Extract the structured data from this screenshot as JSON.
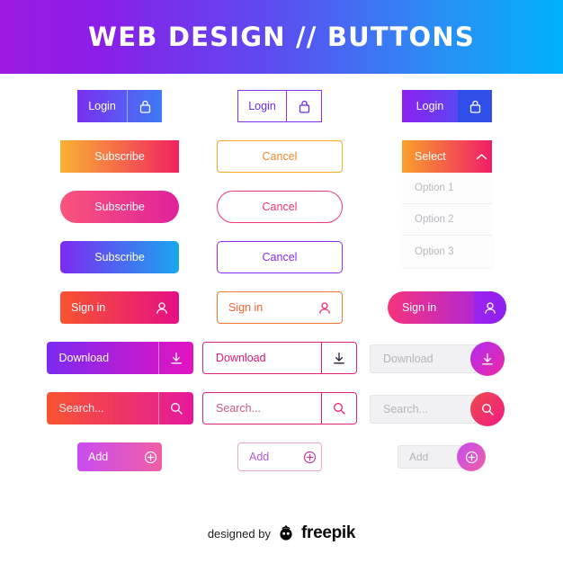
{
  "header": {
    "title": "WEB DESIGN // BUTTONS"
  },
  "footer": {
    "designed_by": "designed by",
    "brand": "freepik",
    "logo_icon": "freepik-robot-icon"
  },
  "columns": [
    {
      "name": "filled-gradient",
      "buttons": [
        {
          "label": "Login",
          "icon": "lock-icon",
          "style": "gradient-violet-blue"
        },
        {
          "label": "Subscribe",
          "icon": "",
          "style": "gradient-orange-pink"
        },
        {
          "label": "Subscribe",
          "icon": "",
          "style": "gradient-pink-magenta-rounded"
        },
        {
          "label": "Subscribe",
          "icon": "",
          "style": "gradient-violet-cyan-rounded"
        },
        {
          "label": "Sign in",
          "icon": "user-icon",
          "style": "gradient-orange-magenta"
        },
        {
          "label": "Download",
          "icon": "download-icon",
          "style": "gradient-violet-magenta"
        },
        {
          "label": "Search...",
          "icon": "search-icon",
          "style": "gradient-orange-magenta"
        },
        {
          "label": "Add",
          "icon": "plus-circle-icon",
          "style": "gradient-purple-pink-rounded"
        }
      ]
    },
    {
      "name": "outline",
      "buttons": [
        {
          "label": "Login",
          "icon": "lock-icon",
          "style": "outline-violet"
        },
        {
          "label": "Cancel",
          "icon": "",
          "style": "outline-orange"
        },
        {
          "label": "Cancel",
          "icon": "",
          "style": "outline-pink-rounded"
        },
        {
          "label": "Cancel",
          "icon": "",
          "style": "outline-violet-rounded"
        },
        {
          "label": "Sign in",
          "icon": "user-icon",
          "style": "outline-orange"
        },
        {
          "label": "Download",
          "icon": "download-icon",
          "style": "outline-pink"
        },
        {
          "label": "Search...",
          "icon": "search-icon",
          "style": "outline-pink"
        },
        {
          "label": "Add",
          "icon": "plus-circle-icon",
          "style": "outline-light-pink"
        }
      ]
    },
    {
      "name": "mixed-select-and-disabled",
      "buttons": [
        {
          "label": "Login",
          "icon": "lock-icon",
          "style": "gradient-violet-blue-dark-icon"
        },
        {
          "label": "Select",
          "icon": "chevron-up-icon",
          "style": "gradient-orange-pink-dropdown",
          "options": [
            "Option 1",
            "Option 2",
            "Option 3"
          ]
        },
        {
          "label": "Sign in",
          "icon": "user-icon",
          "style": "gradient-pink-violet-rounded"
        },
        {
          "label": "Download",
          "icon": "download-icon",
          "style": "disabled-grey-with-circle"
        },
        {
          "label": "Search...",
          "icon": "search-icon",
          "style": "disabled-grey-with-circle"
        },
        {
          "label": "Add",
          "icon": "plus-circle-icon",
          "style": "disabled-grey-with-circle-small"
        }
      ]
    }
  ],
  "colors": {
    "header_start": "#9c1ae0",
    "header_end": "#00b0ff",
    "orange": "#f9a02b",
    "pink": "#ef1d67",
    "magenta": "#e0219b",
    "violet": "#7d2af0",
    "blue": "#1aa7f0",
    "disabled_text": "#b5b5bd",
    "disabled_bg": "#f1f1f3"
  }
}
